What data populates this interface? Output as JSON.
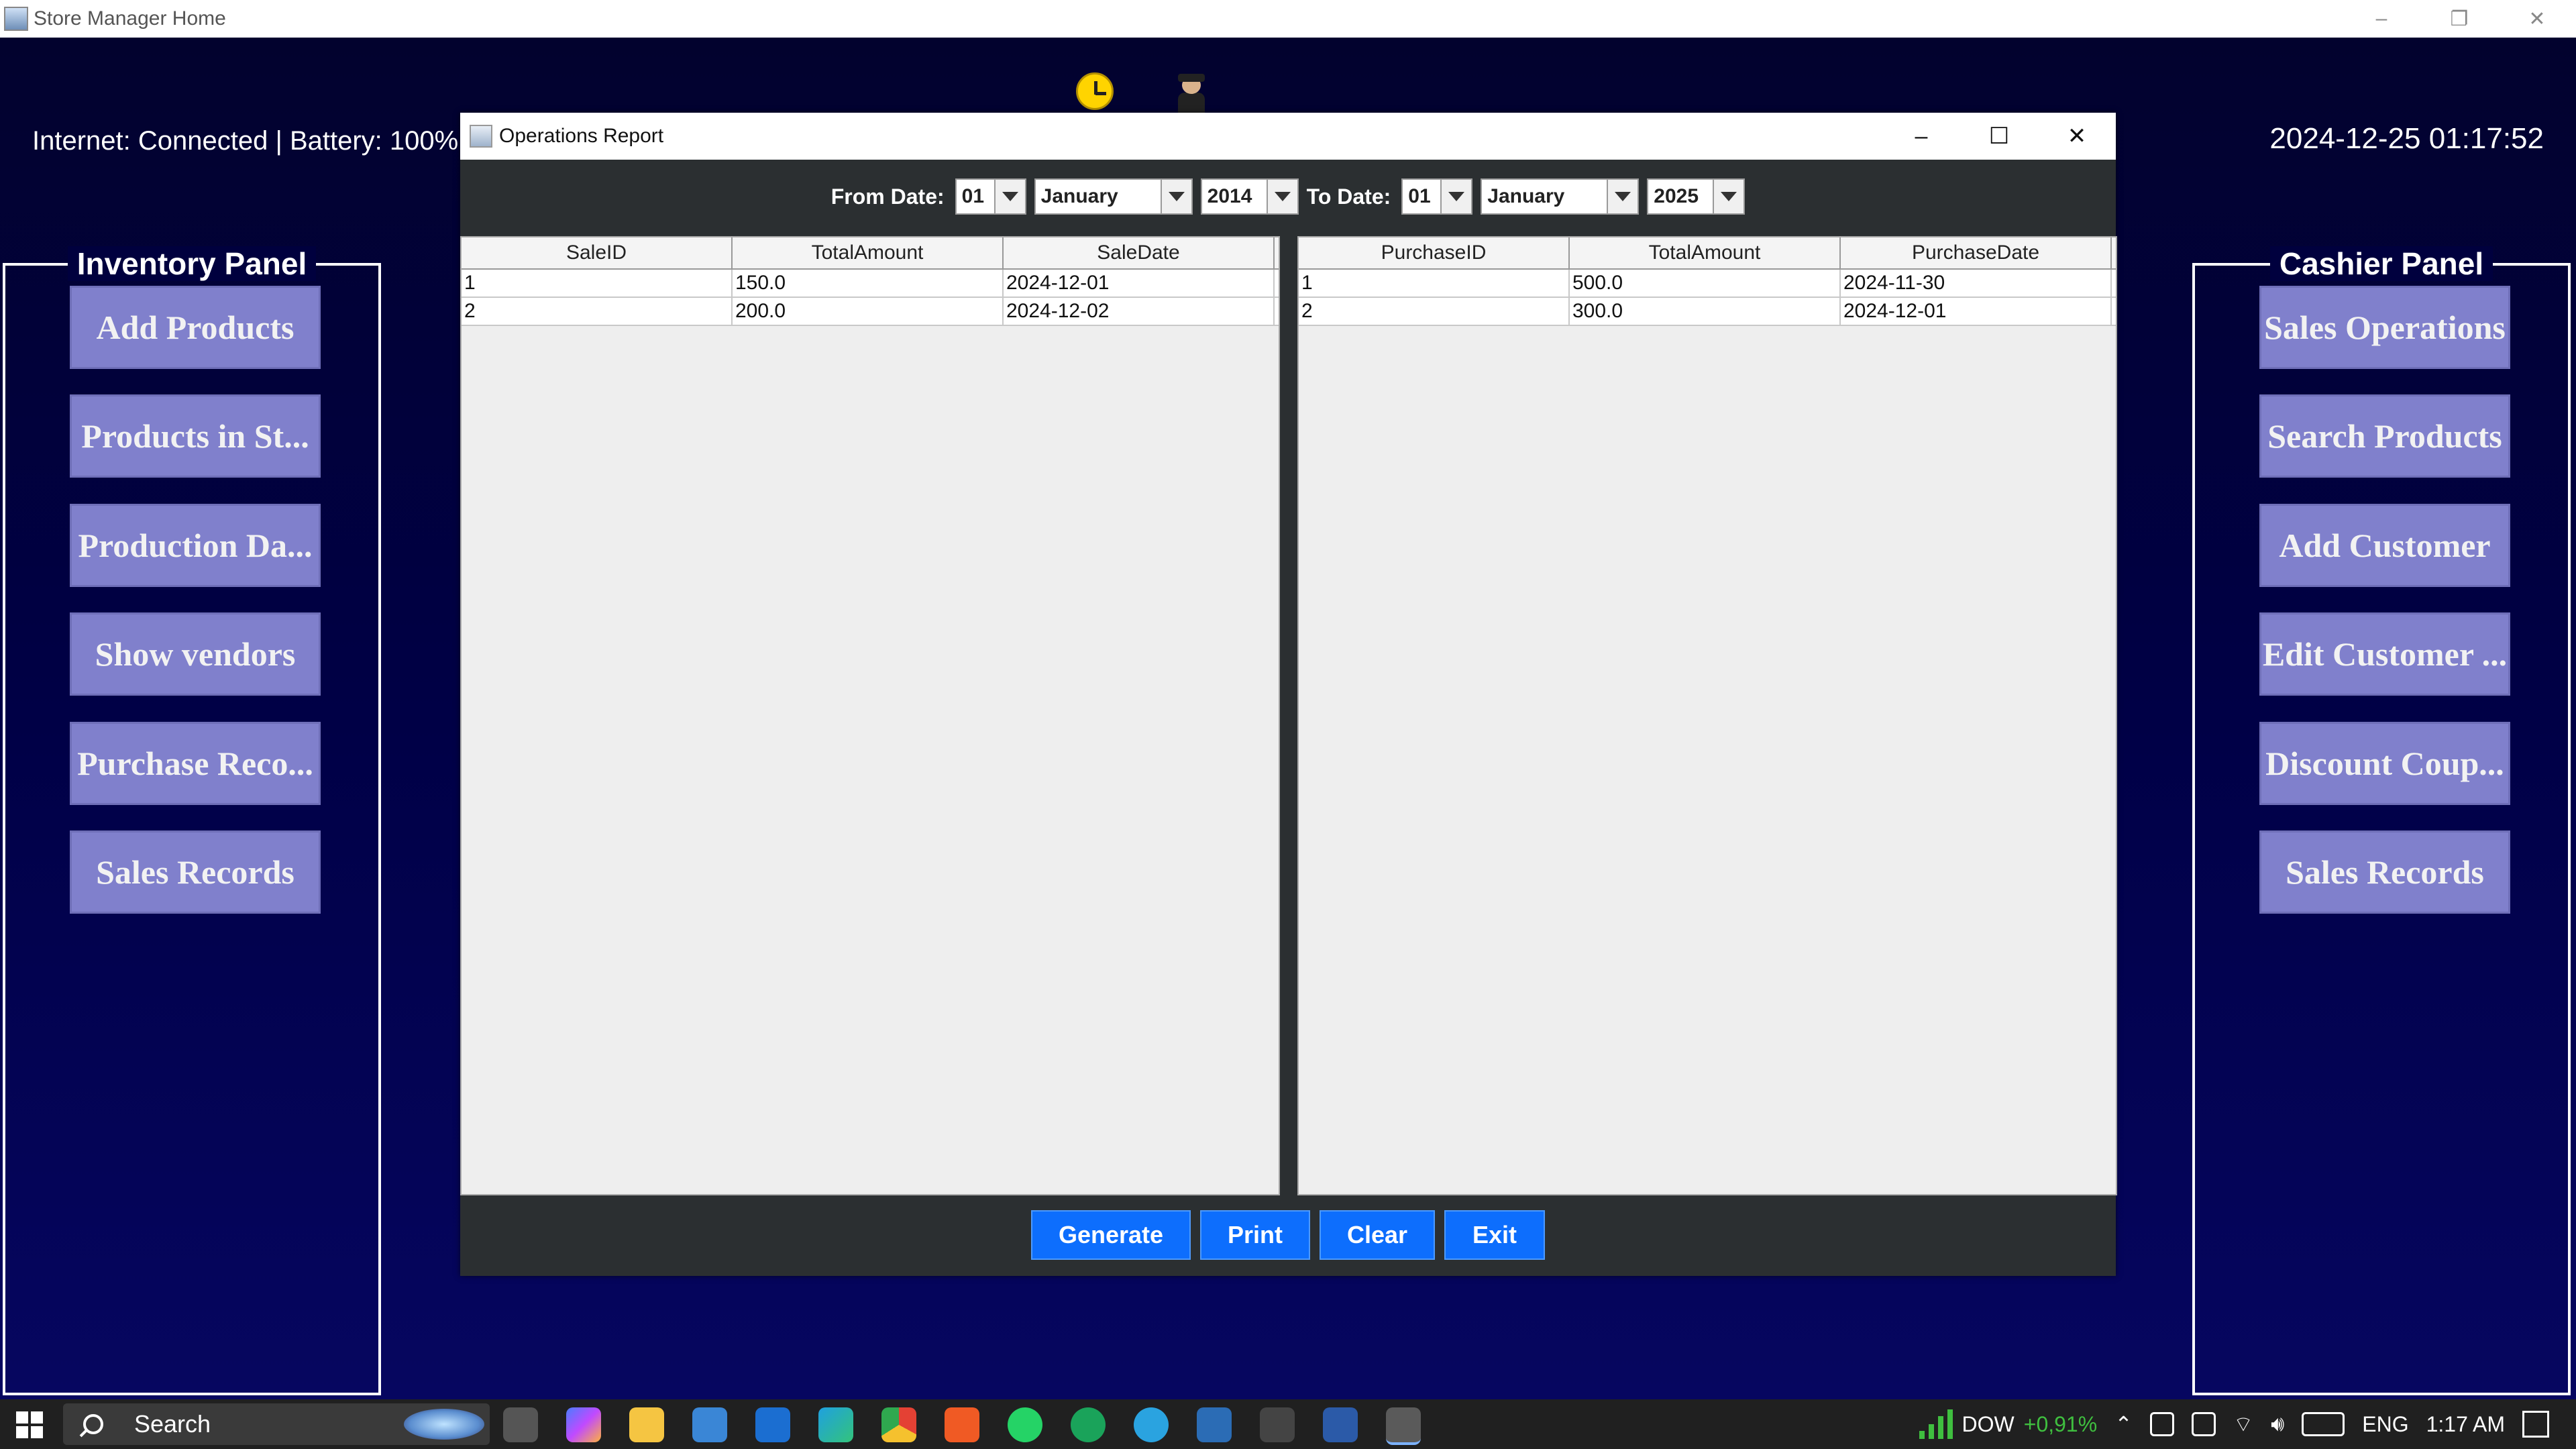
{
  "outer_window": {
    "title": "Store Manager Home",
    "minimize": "–",
    "restore": "❐",
    "close": "✕"
  },
  "status": {
    "connection_text": "Internet: Connected | Battery: 100%",
    "datetime": "2024-12-25 01:17:52"
  },
  "inventory_panel": {
    "title": "Inventory Panel",
    "buttons": [
      "Add Products",
      "Products in St...",
      "Production Da...",
      "Show vendors",
      "Purchase Reco...",
      "Sales Records"
    ]
  },
  "cashier_panel": {
    "title": "Cashier Panel",
    "buttons": [
      "Sales Operations",
      "Search Products",
      "Add Customer",
      "Edit Customer ...",
      "Discount Coup...",
      "Sales Records"
    ]
  },
  "dialog": {
    "title": "Operations Report",
    "minimize": "–",
    "maximize": "☐",
    "close": "✕",
    "from_label": "From Date:",
    "from_day": "01",
    "from_month": "January",
    "from_year": "2014",
    "to_label": "To Date:",
    "to_day": "01",
    "to_month": "January",
    "to_year": "2025",
    "sales_table": {
      "columns": [
        "SaleID",
        "TotalAmount",
        "SaleDate"
      ],
      "rows": [
        [
          "1",
          "150.0",
          "2024-12-01"
        ],
        [
          "2",
          "200.0",
          "2024-12-02"
        ]
      ]
    },
    "purchases_table": {
      "columns": [
        "PurchaseID",
        "TotalAmount",
        "PurchaseDate"
      ],
      "rows": [
        [
          "1",
          "500.0",
          "2024-11-30"
        ],
        [
          "2",
          "300.0",
          "2024-12-01"
        ]
      ]
    },
    "buttons": {
      "generate": "Generate",
      "print": "Print",
      "clear": "Clear",
      "exit": "Exit"
    }
  },
  "taskbar": {
    "search_label": "Search",
    "dow_label": "DOW",
    "dow_change": "+0,91%",
    "language": "ENG",
    "time": "1:17 AM",
    "icons": [
      "task-view-icon",
      "copilot-icon",
      "file-explorer-icon",
      "store-icon",
      "outlook-icon",
      "edge-icon",
      "chrome-icon",
      "brave-icon",
      "whatsapp-icon",
      "whatsapp-business-icon",
      "telegram-icon",
      "app-icon",
      "dsd-icon",
      "word-icon",
      "java-app-icon"
    ]
  },
  "colors": {
    "desktop_bg": "#00003a",
    "panel_button": "#8080cc",
    "action_button": "#0d6efd",
    "dialog_bg": "#2b2f31"
  }
}
